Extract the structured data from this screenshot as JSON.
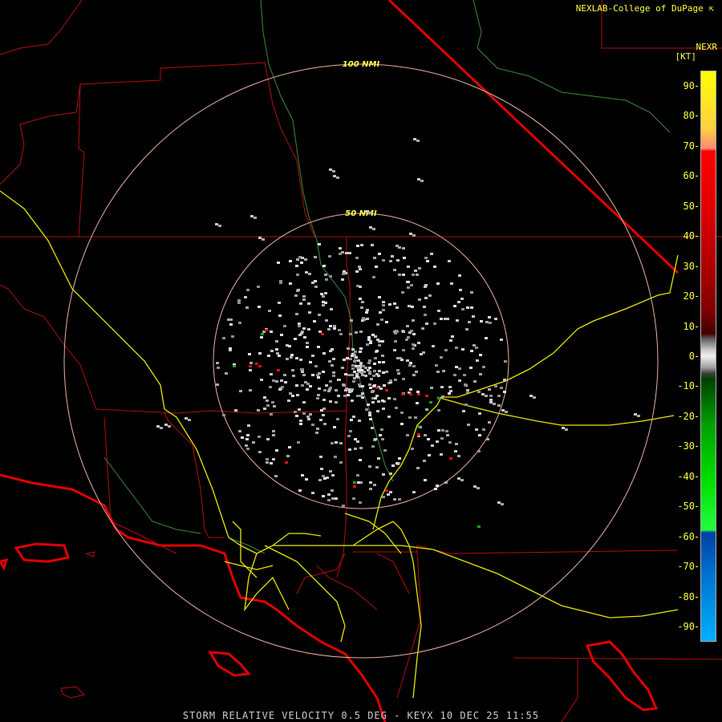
{
  "header": {
    "credit": "NEXLAB-College of DuPage",
    "credit_icon": "cursor-arrow-icon",
    "product": "NEXR",
    "unit": "[KT]"
  },
  "rings": [
    {
      "label": "100 NMI"
    },
    {
      "label": "50 NMI"
    }
  ],
  "legend": {
    "min": -95,
    "max": 95,
    "ticks": [
      90,
      80,
      70,
      60,
      50,
      40,
      30,
      20,
      10,
      0,
      -10,
      -20,
      -30,
      -40,
      -50,
      -60,
      -70,
      -80,
      -90
    ]
  },
  "caption": "STORM RELATIVE VELOCITY 0.5 DEG - KEYX 10 DEC 25 11:55",
  "colors": {
    "background": "#000000",
    "county_lines": "#b01010",
    "state_border": "#e00000",
    "highways": "#e6e600",
    "rivers": "#3a8a3a",
    "range_rings": "#e8b0a0",
    "ring_labels": "#ffff44",
    "returns_gray": "#c8c8c8",
    "returns_red": "#e01010",
    "returns_green": "#20a020"
  }
}
